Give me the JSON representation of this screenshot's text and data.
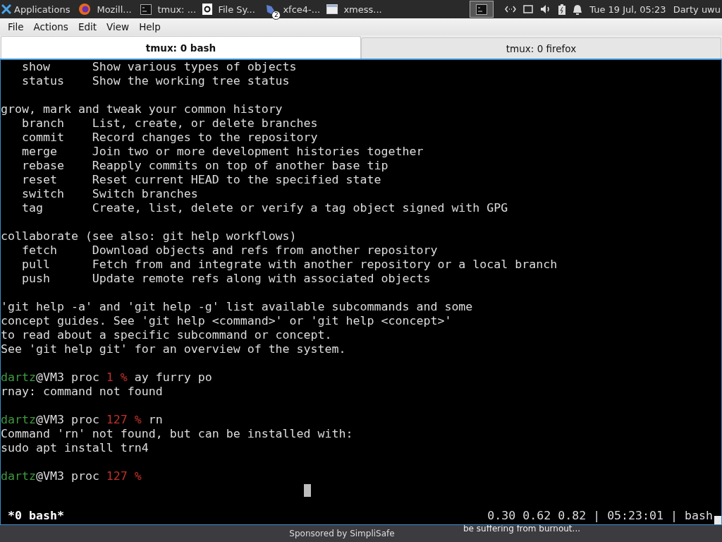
{
  "panel": {
    "apps_label": "Applications",
    "tasks": [
      {
        "label": "Mozill...",
        "kind": "browser",
        "selected": false
      },
      {
        "label": "tmux: ...",
        "kind": "terminal",
        "selected": false
      },
      {
        "label": "File Sy...",
        "kind": "disk",
        "selected": false
      },
      {
        "label": "xfce4-...",
        "kind": "mouse",
        "badge": "2",
        "selected": false
      },
      {
        "label": "xmess...",
        "kind": "window",
        "selected": false
      }
    ],
    "clock": "Tue 19 Jul, 05:23",
    "user": "Darty uwu"
  },
  "menu": [
    "File",
    "Actions",
    "Edit",
    "View",
    "Help"
  ],
  "tabs": [
    {
      "label": "tmux: 0 bash",
      "selected": true
    },
    {
      "label": "tmux: 0 firefox",
      "selected": false
    }
  ],
  "terminal": {
    "blocks": [
      {
        "lines": [
          [
            {
              "text": "   show      Show various types of objects",
              "kind": "plain"
            }
          ],
          [
            {
              "text": "   status    Show the working tree status",
              "kind": "plain"
            }
          ]
        ]
      },
      {
        "lines": [
          [
            {
              "text": "grow, mark and tweak your common history",
              "kind": "plain"
            }
          ],
          [
            {
              "text": "   branch    List, create, or delete branches",
              "kind": "plain"
            }
          ],
          [
            {
              "text": "   commit    Record changes to the repository",
              "kind": "plain"
            }
          ],
          [
            {
              "text": "   merge     Join two or more development histories together",
              "kind": "plain"
            }
          ],
          [
            {
              "text": "   rebase    Reapply commits on top of another base tip",
              "kind": "plain"
            }
          ],
          [
            {
              "text": "   reset     Reset current HEAD to the specified state",
              "kind": "plain"
            }
          ],
          [
            {
              "text": "   switch    Switch branches",
              "kind": "plain"
            }
          ],
          [
            {
              "text": "   tag       Create, list, delete or verify a tag object signed with GPG",
              "kind": "plain"
            }
          ]
        ]
      },
      {
        "lines": [
          [
            {
              "text": "collaborate (see also: git help workflows)",
              "kind": "plain"
            }
          ],
          [
            {
              "text": "   fetch     Download objects and refs from another repository",
              "kind": "plain"
            }
          ],
          [
            {
              "text": "   pull      Fetch from and integrate with another repository or a local branch",
              "kind": "plain"
            }
          ],
          [
            {
              "text": "   push      Update remote refs along with associated objects",
              "kind": "plain"
            }
          ]
        ]
      },
      {
        "lines": [
          [
            {
              "text": "'git help -a' and 'git help -g' list available subcommands and some",
              "kind": "plain"
            }
          ],
          [
            {
              "text": "concept guides. See 'git help <command>' or 'git help <concept>'",
              "kind": "plain"
            }
          ],
          [
            {
              "text": "to read about a specific subcommand or concept.",
              "kind": "plain"
            }
          ],
          [
            {
              "text": "See 'git help git' for an overview of the system.",
              "kind": "plain"
            }
          ]
        ]
      },
      {
        "lines": [
          [
            {
              "text": "dartz",
              "kind": "user"
            },
            {
              "text": "@VM3 proc ",
              "kind": "plain"
            },
            {
              "text": "1 %",
              "kind": "code"
            },
            {
              "text": " ay furry po",
              "kind": "plain"
            }
          ],
          [
            {
              "text": "rnay: command not found",
              "kind": "plain"
            }
          ]
        ]
      },
      {
        "lines": [
          [
            {
              "text": "dartz",
              "kind": "user"
            },
            {
              "text": "@VM3 proc ",
              "kind": "plain"
            },
            {
              "text": "127 %",
              "kind": "code"
            },
            {
              "text": " rn",
              "kind": "plain"
            }
          ],
          [
            {
              "text": "Command 'rn' not found, but can be installed with:",
              "kind": "plain"
            }
          ],
          [
            {
              "text": "sudo apt install trn4",
              "kind": "plain"
            }
          ]
        ]
      },
      {
        "lines": [
          [
            {
              "text": "dartz",
              "kind": "user"
            },
            {
              "text": "@VM3 proc ",
              "kind": "plain"
            },
            {
              "text": "127 %",
              "kind": "code"
            }
          ]
        ]
      }
    ],
    "status_left": "*0 bash*",
    "status_right": "0.30 0.62 0.82 | 05:23:01 | bash"
  },
  "footer": {
    "sponsor": "Sponsored by SimpliSafe",
    "snippet": "be suffering from burnout..."
  }
}
